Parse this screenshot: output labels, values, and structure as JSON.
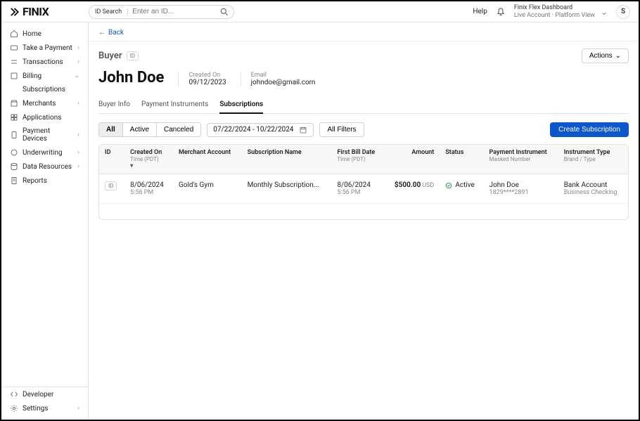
{
  "logo_text": "FINIX",
  "search": {
    "prefix": "ID Search",
    "placeholder": "Enter an ID..."
  },
  "topbar": {
    "help": "Help",
    "dashboard_name": "Finix Flex Dashboard",
    "account_mode": "Live Account",
    "view_mode": "Platform View",
    "avatar_initial": "S"
  },
  "sidebar": {
    "home": "Home",
    "take_payment": "Take a Payment",
    "transactions": "Transactions",
    "billing": "Billing",
    "billing_sub": "Subscriptions",
    "merchants": "Merchants",
    "applications": "Applications",
    "payment_devices": "Payment Devices",
    "underwriting": "Underwriting",
    "data_resources": "Data Resources",
    "reports": "Reports",
    "developer": "Developer",
    "settings": "Settings"
  },
  "back_label": "Back",
  "page": {
    "entity_label": "Buyer",
    "id_chip": "ID",
    "actions_label": "Actions",
    "name": "John Doe",
    "meta": [
      {
        "label": "Created On",
        "value": "09/12/2023"
      },
      {
        "label": "Email",
        "value": "johndoe@gmail.com"
      }
    ]
  },
  "tabs": {
    "buyer_info": "Buyer Info",
    "payment_instruments": "Payment Instruments",
    "subscriptions": "Subscriptions"
  },
  "filters": {
    "all": "All",
    "active": "Active",
    "canceled": "Canceled",
    "date_range": "07/22/2024 - 10/22/2024",
    "all_filters": "All Filters",
    "create": "Create Subscription"
  },
  "table": {
    "headers": {
      "id": "ID",
      "created_on": "Created On",
      "created_on_sub": "Time (PDT)",
      "merchant": "Merchant Account",
      "sub_name": "Subscription Name",
      "first_bill": "First Bill Date",
      "first_bill_sub": "Time (PDT)",
      "amount": "Amount",
      "status": "Status",
      "payment_instrument": "Payment Instrument",
      "payment_instrument_sub": "Masked Number",
      "instrument_type": "Instrument Type",
      "instrument_type_sub": "Brand / Type"
    },
    "rows": [
      {
        "id_chip": "ID",
        "created_date": "8/06/2024",
        "created_time": "5:56 PM",
        "merchant": "Gold's Gym",
        "sub_name": "Monthly Subscription...",
        "first_bill_date": "8/06/2024",
        "first_bill_time": "5:56 PM",
        "amount": "$500.00",
        "currency": "USD",
        "status": "Active",
        "pi_name": "John Doe",
        "pi_masked": "1829****2891",
        "it_type": "Bank Account",
        "it_brand": "Business Checking"
      }
    ]
  }
}
